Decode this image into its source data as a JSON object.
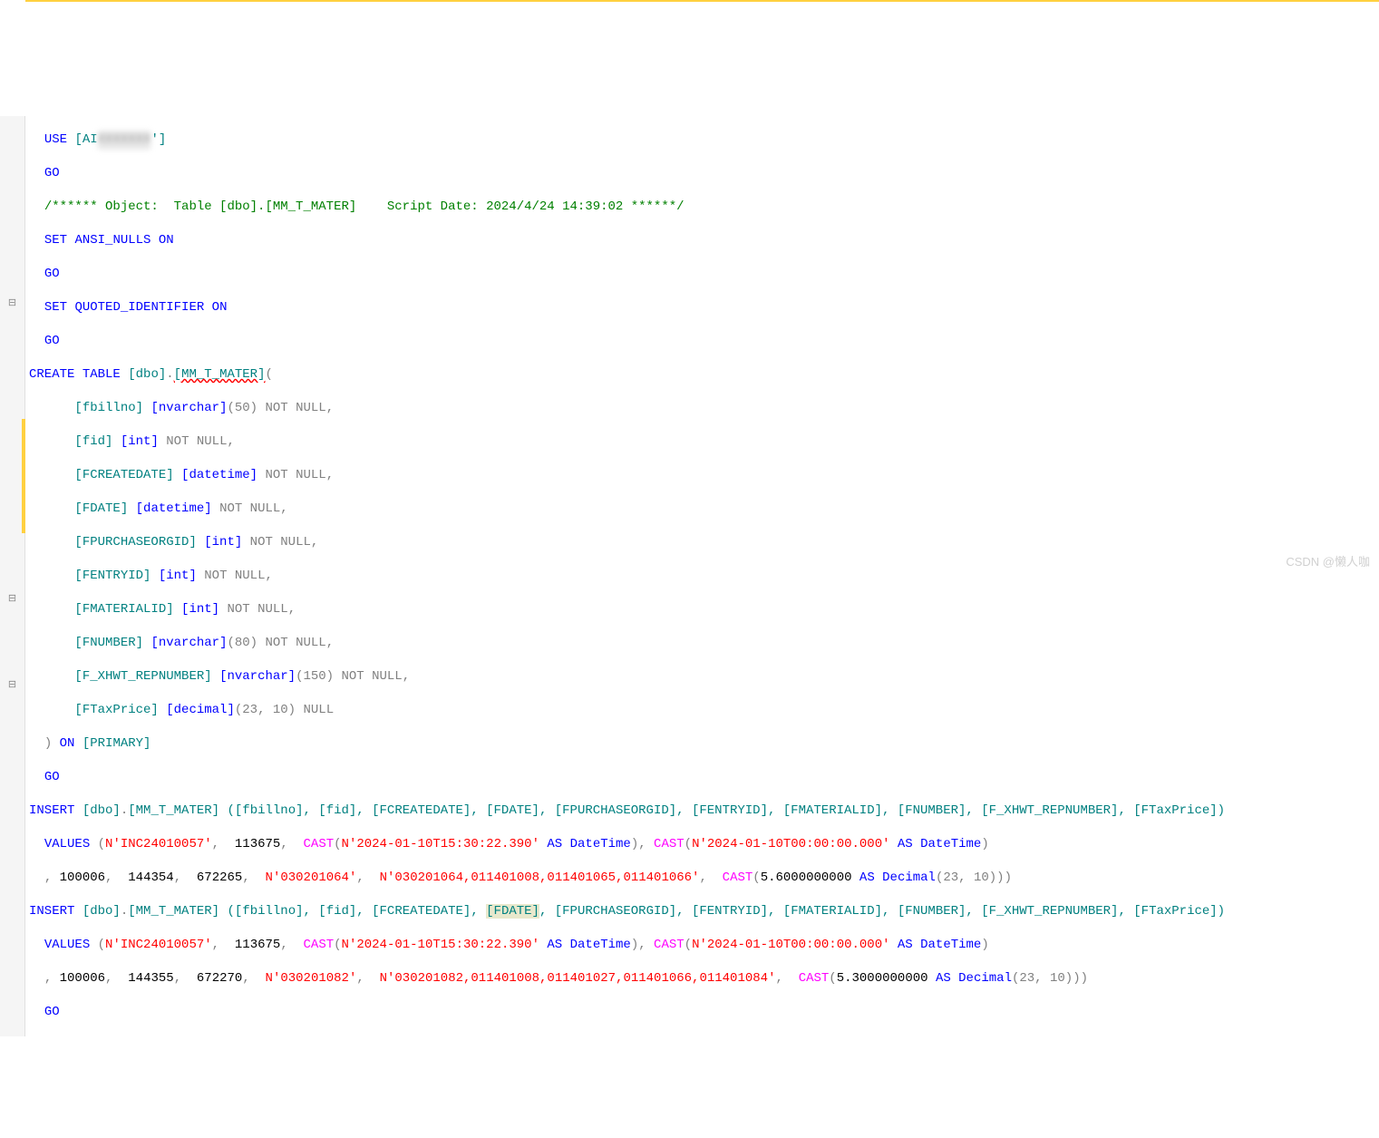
{
  "code": {
    "use_db": "AI",
    "db_blur": "XXXXXXX",
    "go": "GO",
    "comment": "/****** Object:  Table [dbo].[MM_T_MATER]    Script Date: 2024/4/24 14:39:02 ******/",
    "set_ansi": "ANSI_NULLS",
    "set_quoted": "QUOTED_IDENTIFIER",
    "on_kw": "ON",
    "set_kw": "SET",
    "use_kw": "USE",
    "create": "CREATE",
    "table_kw": "TABLE",
    "dbo": "[dbo]",
    "tbl": "[MM_T_MATER]",
    "cols": {
      "c1": {
        "name": "[fbillno]",
        "type": "[nvarchar]",
        "size": "(50)",
        "null": "NOT NULL"
      },
      "c2": {
        "name": "[fid]",
        "type": "[int]",
        "null": "NOT NULL"
      },
      "c3": {
        "name": "[FCREATEDATE]",
        "type": "[datetime]",
        "null": "NOT NULL"
      },
      "c4": {
        "name": "[FDATE]",
        "type": "[datetime]",
        "null": "NOT NULL"
      },
      "c5": {
        "name": "[FPURCHASEORGID]",
        "type": "[int]",
        "null": "NOT NULL"
      },
      "c6": {
        "name": "[FENTRYID]",
        "type": "[int]",
        "null": "NOT NULL"
      },
      "c7": {
        "name": "[FMATERIALID]",
        "type": "[int]",
        "null": "NOT NULL"
      },
      "c8": {
        "name": "[FNUMBER]",
        "type": "[nvarchar]",
        "size": "(80)",
        "null": "NOT NULL"
      },
      "c9": {
        "name": "[F_XHWT_REPNUMBER]",
        "type": "[nvarchar]",
        "size": "(150)",
        "null": "NOT NULL"
      },
      "c10": {
        "name": "[FTaxPrice]",
        "type": "[decimal]",
        "size": "(23, 10)",
        "null": "NULL"
      }
    },
    "primary": "[PRIMARY]",
    "insert_kw": "INSERT",
    "values_kw": "VALUES",
    "cast_kw": "CAST",
    "as_kw": "AS",
    "datetime_kw": "DateTime",
    "decimal_kw": "Decimal",
    "cols_list": "([fbillno], [fid], [FCREATEDATE], [FDATE], [FPURCHASEORGID], [FENTRYID], [FMATERIALID], [FNUMBER], [F_XHWT_REPNUMBER], [FTaxPrice])",
    "cols_list_pre": "([fbillno], [fid], [FCREATEDATE], ",
    "cols_list_fdate": "[FDATE]",
    "cols_list_post": ", [FPURCHASEORGID], [FENTRYID], [FMATERIALID], [FNUMBER], [F_XHWT_REPNUMBER], [FTaxPrice])",
    "v1": {
      "s1": "N'INC24010057'",
      "n1": "113675",
      "d1": "N'2024-01-10T15:30:22.390'",
      "d2": "N'2024-01-10T00:00:00.000'",
      "n2": "100006",
      "n3": "144354",
      "n4": "672265",
      "s2": "N'030201064'",
      "s3": "N'030201064,011401008,011401065,011401066'",
      "dec": "5.6000000000",
      "decsize": "(23, 10)"
    },
    "v2": {
      "s1": "N'INC24010057'",
      "n1": "113675",
      "d1": "N'2024-01-10T15:30:22.390'",
      "d2": "N'2024-01-10T00:00:00.000'",
      "n2": "100006",
      "n3": "144355",
      "n4": "672270",
      "s2": "N'030201082'",
      "s3": "N'030201082,011401008,011401027,011401066,011401084'",
      "dec": "5.3000000000",
      "decsize": "(23, 10)"
    }
  },
  "watermark": "CSDN @懒人咖",
  "fold": {
    "minus": "⊟"
  }
}
